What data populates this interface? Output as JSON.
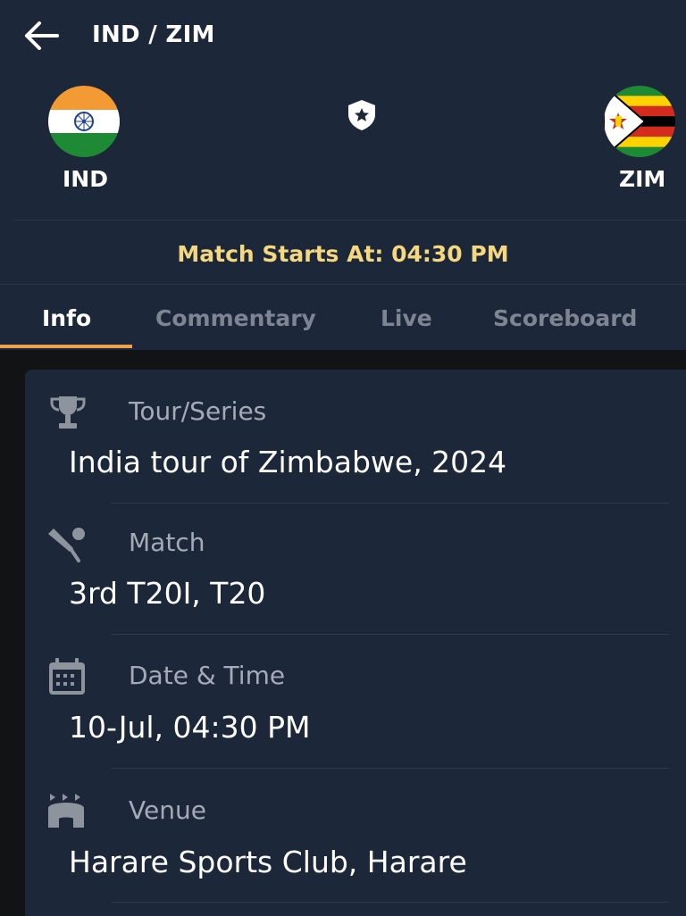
{
  "header": {
    "title": "IND / ZIM",
    "home_team": "IND",
    "away_team": "ZIM",
    "match_start": "Match Starts At: 04:30 PM"
  },
  "tabs": [
    {
      "label": "Info",
      "active": true
    },
    {
      "label": "Commentary",
      "active": false
    },
    {
      "label": "Live",
      "active": false
    },
    {
      "label": "Scoreboard",
      "active": false
    }
  ],
  "info": {
    "series_label": "Tour/Series",
    "series_value": "India tour of Zimbabwe, 2024",
    "match_label": "Match",
    "match_value": "3rd T20I, T20",
    "datetime_label": "Date & Time",
    "datetime_value": "10-Jul, 04:30 PM",
    "venue_label": "Venue",
    "venue_value": "Harare Sports Club, Harare"
  },
  "colors": {
    "header_bg": "#1c2839",
    "accent": "#f0a04b",
    "start_text": "#f5d77f"
  },
  "icons": {
    "back": "arrow-left-icon",
    "shield": "shield-star-icon",
    "series": "trophy-icon",
    "match": "cricket-bat-icon",
    "datetime": "calendar-icon",
    "venue": "stadium-icon"
  }
}
